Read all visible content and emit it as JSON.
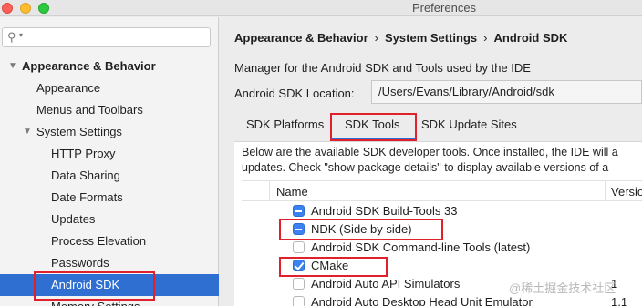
{
  "window": {
    "title": "Preferences"
  },
  "search": {
    "placeholder": ""
  },
  "sidebar": {
    "items": [
      {
        "label": "Appearance & Behavior"
      },
      {
        "label": "Appearance"
      },
      {
        "label": "Menus and Toolbars"
      },
      {
        "label": "System Settings"
      },
      {
        "label": "HTTP Proxy"
      },
      {
        "label": "Data Sharing"
      },
      {
        "label": "Date Formats"
      },
      {
        "label": "Updates"
      },
      {
        "label": "Process Elevation"
      },
      {
        "label": "Passwords"
      },
      {
        "label": "Android SDK"
      },
      {
        "label": "Memory Settings"
      }
    ]
  },
  "breadcrumb": {
    "part1": "Appearance & Behavior",
    "part2": "System Settings",
    "part3": "Android SDK",
    "separator": "›"
  },
  "main": {
    "description": "Manager for the Android SDK and Tools used by the IDE",
    "location_label": "Android SDK Location:",
    "location_value": "/Users/Evans/Library/Android/sdk",
    "tabs": [
      {
        "label": "SDK Platforms"
      },
      {
        "label": "SDK Tools"
      },
      {
        "label": "SDK Update Sites"
      }
    ],
    "content_line1": "Below are the available SDK developer tools. Once installed, the IDE will a",
    "content_line2": "updates. Check \"show package details\" to display available versions of a",
    "table": {
      "header_name": "Name",
      "header_version": "Versio",
      "rows": [
        {
          "name": "Android SDK Build-Tools 33",
          "state": "partial",
          "version": ""
        },
        {
          "name": "NDK (Side by side)",
          "state": "partial",
          "version": ""
        },
        {
          "name": "Android SDK Command-line Tools (latest)",
          "state": "unchecked",
          "version": ""
        },
        {
          "name": "CMake",
          "state": "checked",
          "version": ""
        },
        {
          "name": "Android Auto API Simulators",
          "state": "unchecked",
          "version": "1"
        },
        {
          "name": "Android Auto Desktop Head Unit Emulator",
          "state": "unchecked",
          "version": "1.1"
        }
      ]
    }
  },
  "watermark": "@稀土掘金技术社区",
  "colors": {
    "selection": "#2f6fd1",
    "highlight": "#e0202a",
    "checkbox": "#3b82f0"
  }
}
